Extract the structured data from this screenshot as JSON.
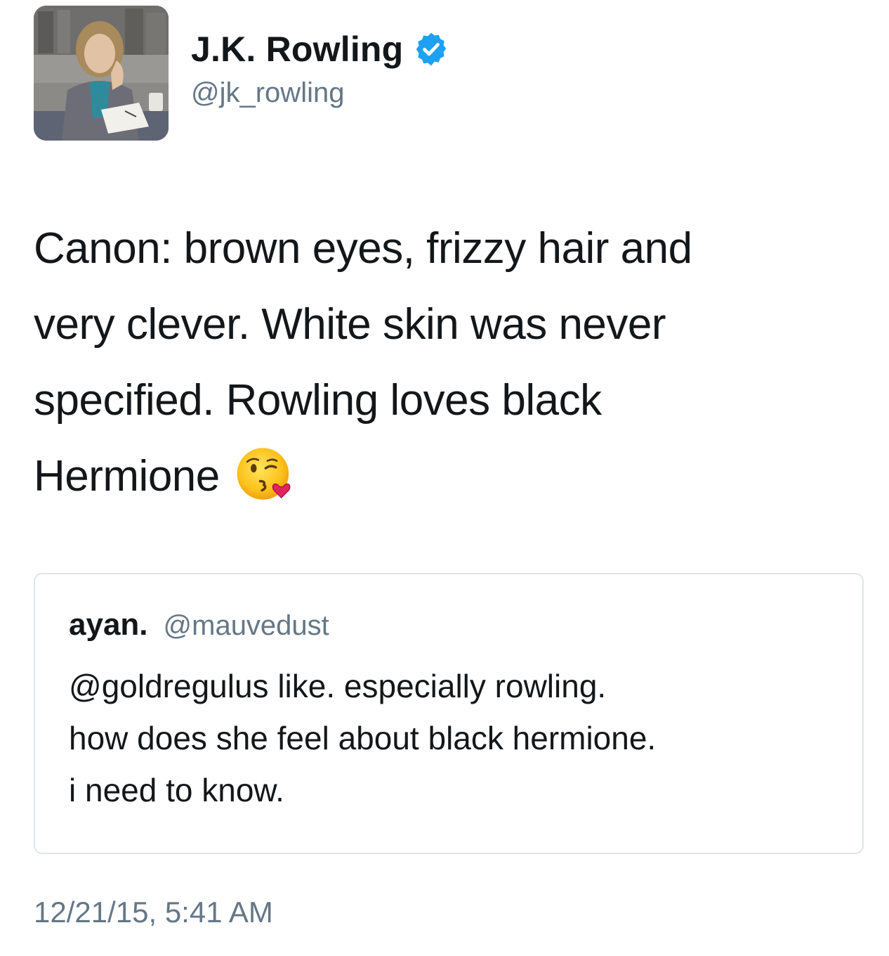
{
  "author": {
    "display_name": "J.K. Rowling",
    "handle": "@jk_rowling",
    "verified": true,
    "avatar_icon": "author-photo"
  },
  "tweet": {
    "text_lines": [
      "Canon: brown eyes, frizzy hair and",
      "very clever. White skin was never",
      "specified. Rowling loves black",
      "Hermione"
    ],
    "emoji": "face-throwing-a-kiss"
  },
  "quoted_tweet": {
    "display_name": "ayan.",
    "handle": "@mauvedust",
    "text_lines": [
      "@goldregulus like. especially rowling.",
      "how does she feel about black hermione.",
      "i need to know."
    ]
  },
  "timestamp": "12/21/15, 5:41 AM",
  "colors": {
    "text_primary": "#14171a",
    "text_secondary": "#657786",
    "verified_blue": "#1da1f2",
    "card_border": "#dfe4e8"
  }
}
